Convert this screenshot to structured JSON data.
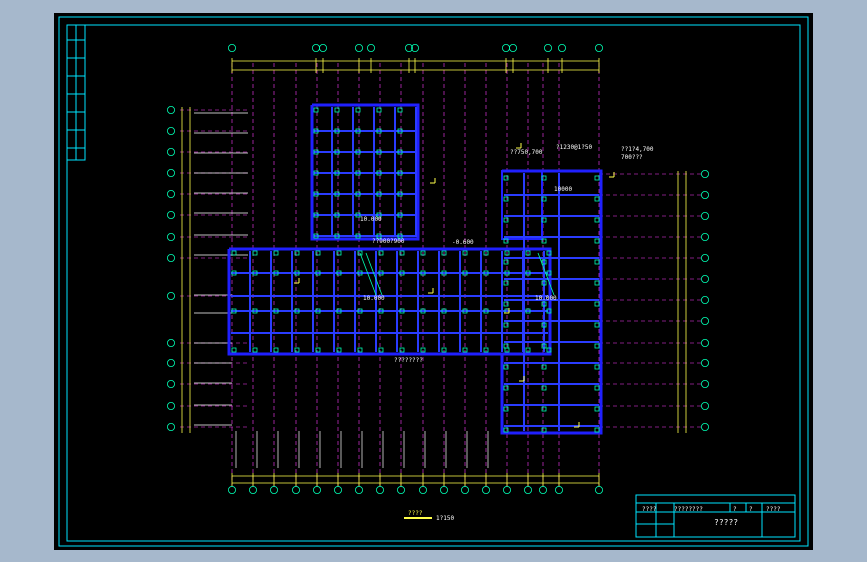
{
  "colors": {
    "background": "#000000",
    "frame": "#00e5ff",
    "wall": "#2020ff",
    "beam": "#2a3cff",
    "axis_dash": "#ff3cff",
    "dimension": "#ffff4a",
    "column": "#00ffb4",
    "text": "#ffffff"
  },
  "annotations": {
    "a1": "??750,700",
    "a2": "??1?4,700",
    "a3": "?1230@1?50",
    "a4": "700???",
    "a5": "10.000",
    "a6": "10000",
    "a7": "??900?900",
    "a8": "-0.600",
    "a9": "10.000",
    "a10": "10.000",
    "a11": "????????"
  },
  "scale_bar": {
    "label": "????",
    "ratio": "1?150"
  },
  "title_block": {
    "c1": "????",
    "c2": "????????",
    "c3": "?",
    "c4": "?",
    "c5": "????",
    "title": "?????"
  }
}
